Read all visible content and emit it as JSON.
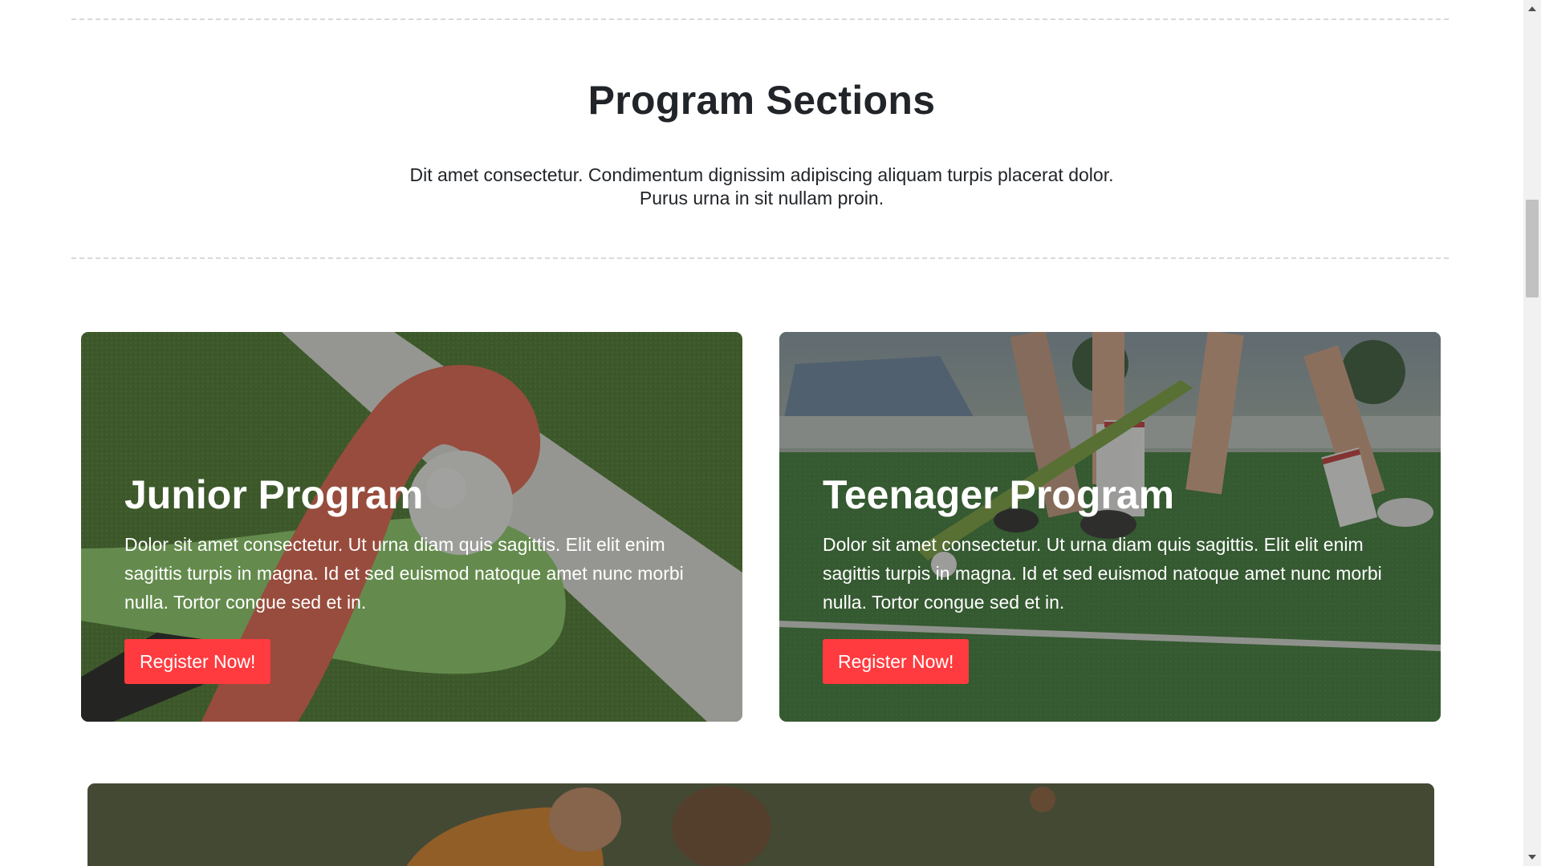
{
  "section": {
    "title": "Program Sections",
    "subtitle": "Dit amet consectetur. Condimentum dignissim adipiscing aliquam turpis placerat dolor. Purus urna in sit nullam proin."
  },
  "cards": [
    {
      "title": "Junior Program",
      "text": "Dolor sit amet consectetur. Ut urna diam quis sagittis. Elit elit enim sagittis turpis in magna. Id et sed euismod natoque amet nunc morbi nulla. Tortor congue sed et in.",
      "button_label": "Register Now!"
    },
    {
      "title": "Teenager Program",
      "text": "Dolor sit amet consectetur. Ut urna diam quis sagittis. Elit elit enim sagittis turpis in magna. Id et sed euismod natoque amet nunc morbi nulla. Tortor congue sed et in.",
      "button_label": "Register Now!"
    }
  ],
  "colors": {
    "accent": "#ff3b3f",
    "heading": "#212529",
    "divider": "#d9d9d9"
  },
  "icons": {
    "scroll_up": "scroll-up-arrow-icon",
    "scroll_down": "scroll-down-arrow-icon"
  }
}
